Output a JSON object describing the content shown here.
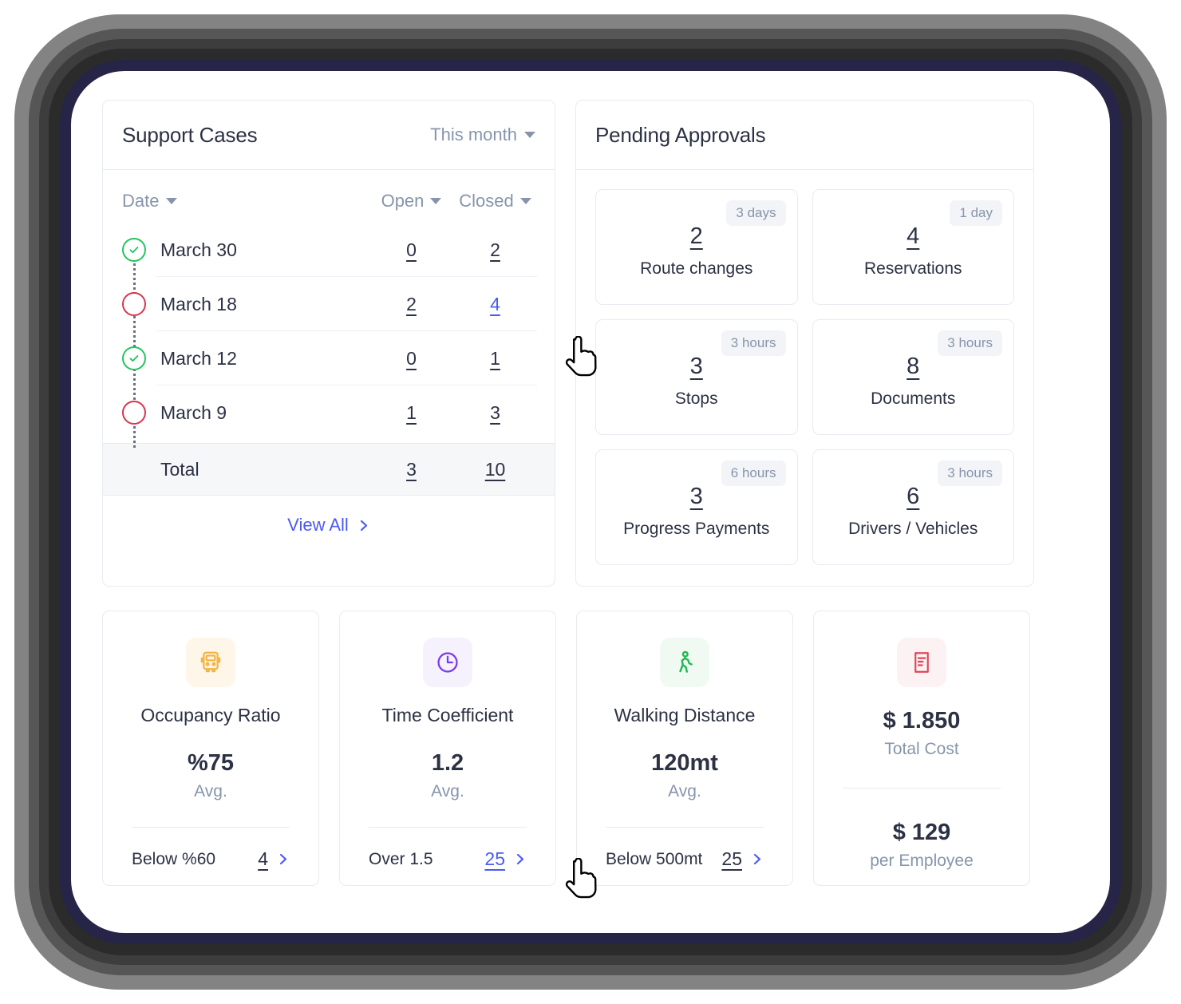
{
  "support_cases": {
    "title": "Support Cases",
    "period": "This month",
    "period_icon": "chevron-down-icon",
    "columns": {
      "date": "Date",
      "open": "Open",
      "closed": "Closed"
    },
    "rows": [
      {
        "status": "closed",
        "date": "March 30",
        "open": "0",
        "closed": "2",
        "closed_active": false
      },
      {
        "status": "open",
        "date": "March 18",
        "open": "2",
        "closed": "4",
        "closed_active": true
      },
      {
        "status": "closed",
        "date": "March 12",
        "open": "0",
        "closed": "1",
        "closed_active": false
      },
      {
        "status": "open",
        "date": "March 9",
        "open": "1",
        "closed": "3",
        "closed_active": false
      }
    ],
    "total": {
      "label": "Total",
      "open": "3",
      "closed": "10"
    },
    "view_all": "View All",
    "view_all_icon": "chevron-right-icon"
  },
  "pending_approvals": {
    "title": "Pending Approvals",
    "cards": [
      {
        "count": "2",
        "label": "Route changes",
        "badge": "3 days"
      },
      {
        "count": "4",
        "label": "Reservations",
        "badge": "1 day"
      },
      {
        "count": "3",
        "label": "Stops",
        "badge": "3 hours"
      },
      {
        "count": "8",
        "label": "Documents",
        "badge": "3 hours"
      },
      {
        "count": "3",
        "label": "Progress Payments",
        "badge": "6 hours"
      },
      {
        "count": "6",
        "label": "Drivers / Vehicles",
        "badge": "3 hours"
      }
    ]
  },
  "metrics": [
    {
      "icon": "bus-icon",
      "icon_color": "#f5b344",
      "icon_bg": "#fdf6e9",
      "title": "Occupancy Ratio",
      "value": "%75",
      "sub": "Avg.",
      "foot_label": "Below %60",
      "foot_value": "4",
      "foot_active": false
    },
    {
      "icon": "clock-icon",
      "icon_color": "#7c3aed",
      "icon_bg": "#f5f2fe",
      "title": "Time Coefficient",
      "value": "1.2",
      "sub": "Avg.",
      "foot_label": "Over 1.5",
      "foot_value": "25",
      "foot_active": true
    },
    {
      "icon": "walking-icon",
      "icon_color": "#1dba4e",
      "icon_bg": "#f0faf3",
      "title": "Walking Distance",
      "value": "120mt",
      "sub": "Avg.",
      "foot_label": "Below 500mt",
      "foot_value": "25",
      "foot_active": false
    }
  ],
  "total_cost": {
    "icon": "invoice-icon",
    "icon_color": "#e04456",
    "icon_bg": "#fdf2f3",
    "value": "$ 1.850",
    "label": "Total Cost",
    "value2": "$ 129",
    "label2": "per Employee"
  },
  "colors": {
    "accent_blue": "#4a5bf5",
    "status_green": "#22c55e",
    "status_red": "#d7374f",
    "text_dark": "#2c3144",
    "text_muted": "#8795ac"
  }
}
